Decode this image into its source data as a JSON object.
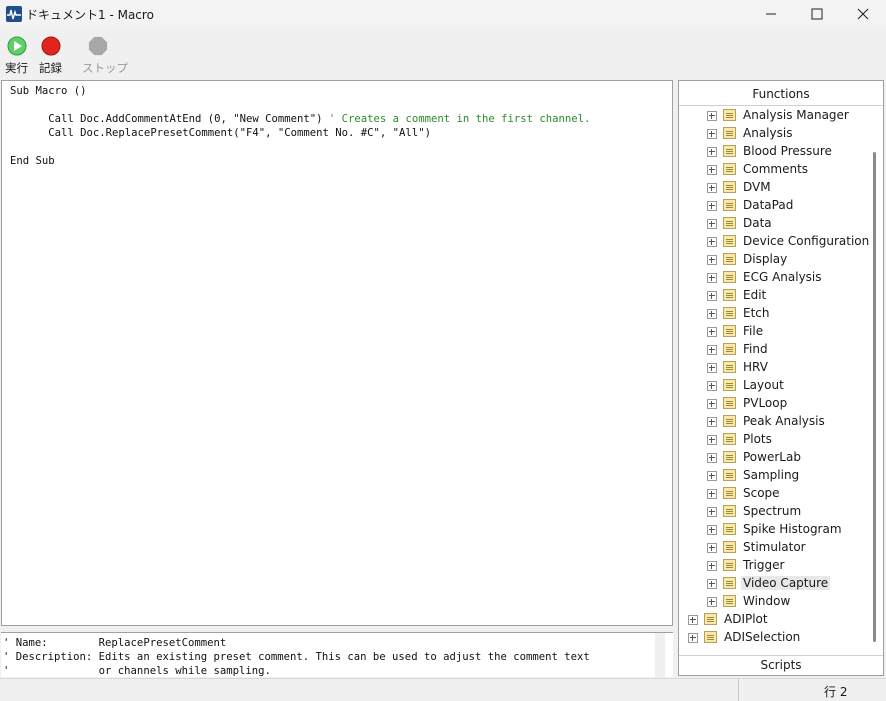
{
  "window": {
    "title": "ドキュメント1 - Macro",
    "minimize_icon": "minimize-icon",
    "maximize_icon": "maximize-icon",
    "close_icon": "close-icon"
  },
  "toolbar": {
    "run_label": "実行",
    "record_label": "記録",
    "stop_label": "ストップ",
    "run_color": "#3cb043",
    "record_color": "#e02020",
    "stop_color": "#a8a8a8"
  },
  "editor": {
    "line1": "Sub Macro ()",
    "line2": "",
    "line3_code": "      Call Doc.AddCommentAtEnd (0, \"New Comment\") ",
    "line3_comment": "' Creates a comment in the first channel.",
    "line4": "      Call Doc.ReplacePresetComment(\"F4\", \"Comment No. #C\", \"All\")",
    "line5": "",
    "line6": "End Sub"
  },
  "description": {
    "line1": "' Name:        ReplacePresetComment",
    "line2": "' Description: Edits an existing preset comment. This can be used to adjust the comment text",
    "line3": "'              or channels while sampling."
  },
  "functions_panel": {
    "header": "Functions",
    "items": [
      "Analysis Manager",
      "Analysis",
      "Blood Pressure",
      "Comments",
      "DVM",
      "DataPad",
      "Data",
      "Device Configuration",
      "Display",
      "ECG Analysis",
      "Edit",
      "Etch",
      "File",
      "Find",
      "HRV",
      "Layout",
      "PVLoop",
      "Peak Analysis",
      "Plots",
      "PowerLab",
      "Sampling",
      "Scope",
      "Spectrum",
      "Spike Histogram",
      "Stimulator",
      "Trigger",
      "Video Capture",
      "Window"
    ],
    "selected_item": "Video Capture",
    "root_items": [
      "ADIPlot",
      "ADISelection"
    ],
    "footer": "Scripts"
  },
  "status": {
    "line": "行 2"
  }
}
